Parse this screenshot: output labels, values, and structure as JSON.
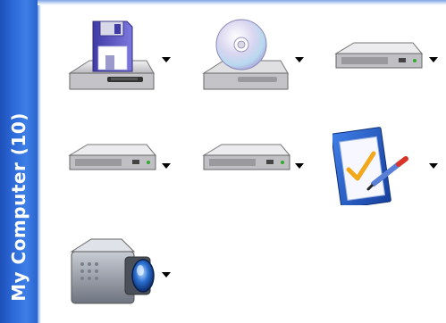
{
  "group": {
    "title": "My Computer (10)"
  },
  "items": [
    {
      "icon": "floppy-drive-icon"
    },
    {
      "icon": "cd-drive-icon"
    },
    {
      "icon": "hard-drive-icon"
    },
    {
      "icon": "hard-drive-icon"
    },
    {
      "icon": "hard-drive-icon"
    },
    {
      "icon": "control-panel-check-icon"
    },
    {
      "icon": "video-camera-icon"
    }
  ],
  "colors": {
    "sidebar": "#2d6ad9",
    "drive_body": "#c9c9cc",
    "floppy_blue": "#5b57c4",
    "arrow": "#000000"
  }
}
